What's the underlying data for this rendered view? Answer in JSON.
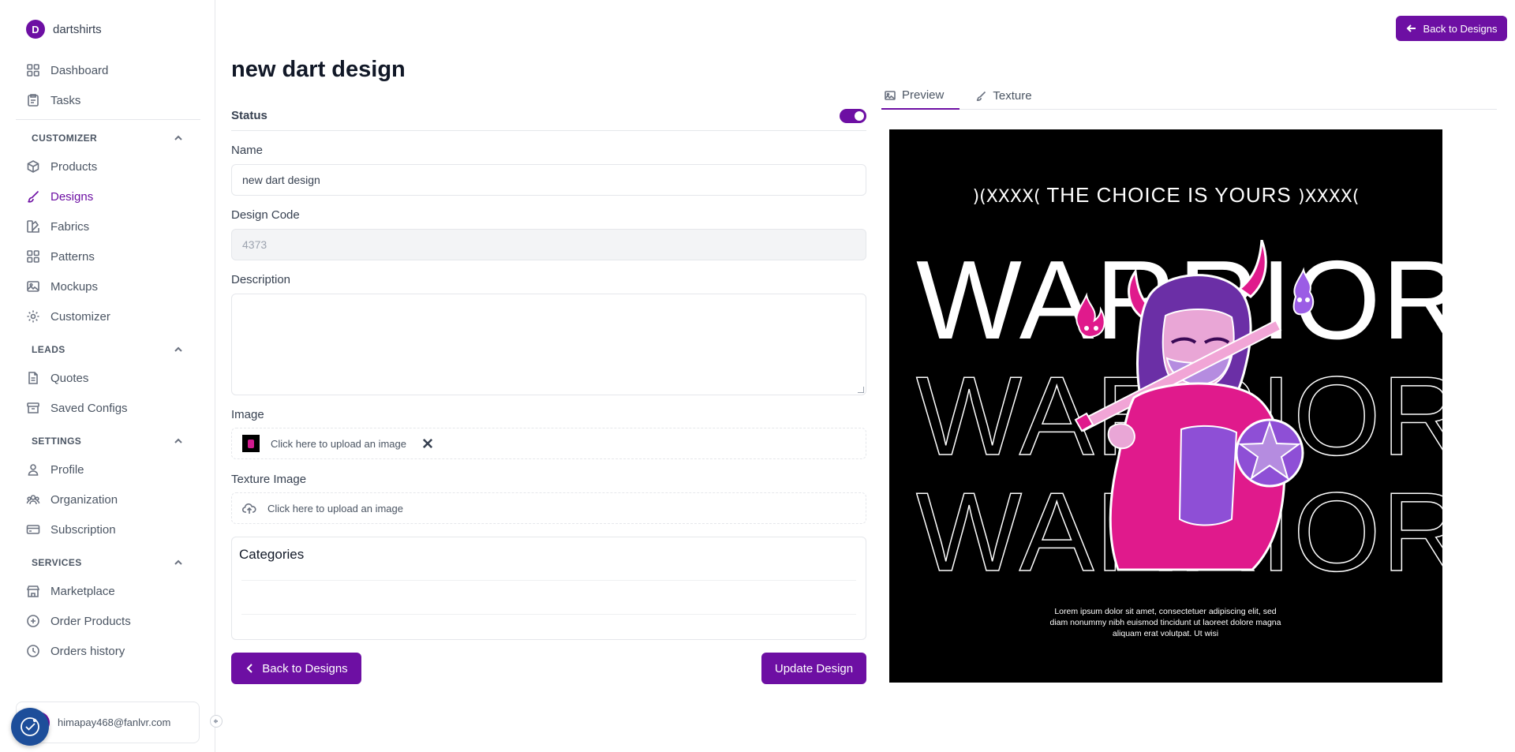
{
  "brand": {
    "initial": "D",
    "name": "dartshirts"
  },
  "sidebar": {
    "main_items": [
      {
        "label": "Dashboard",
        "icon": "grid-icon"
      },
      {
        "label": "Tasks",
        "icon": "clipboard-icon"
      }
    ],
    "sections": [
      {
        "title": "CUSTOMIZER",
        "items": [
          {
            "label": "Products",
            "icon": "box-icon"
          },
          {
            "label": "Designs",
            "icon": "brush-icon",
            "active": true
          },
          {
            "label": "Fabrics",
            "icon": "swatch-icon"
          },
          {
            "label": "Patterns",
            "icon": "grid-icon"
          },
          {
            "label": "Mockups",
            "icon": "image-icon"
          },
          {
            "label": "Customizer",
            "icon": "gear-icon"
          }
        ]
      },
      {
        "title": "LEADS",
        "items": [
          {
            "label": "Quotes",
            "icon": "file-icon"
          },
          {
            "label": "Saved Configs",
            "icon": "archive-icon"
          }
        ]
      },
      {
        "title": "SETTINGS",
        "items": [
          {
            "label": "Profile",
            "icon": "user-icon"
          },
          {
            "label": "Organization",
            "icon": "users-icon"
          },
          {
            "label": "Subscription",
            "icon": "card-icon"
          }
        ]
      },
      {
        "title": "SERVICES",
        "items": [
          {
            "label": "Marketplace",
            "icon": "store-icon"
          },
          {
            "label": "Order Products",
            "icon": "plus-circle-icon"
          },
          {
            "label": "Orders history",
            "icon": "clock-icon"
          }
        ]
      }
    ],
    "user_email": "himapay468@fanlvr.com"
  },
  "header": {
    "back_label": "Back to Designs"
  },
  "form": {
    "title": "new dart design",
    "status_label": "Status",
    "status_on": true,
    "name_label": "Name",
    "name_value": "new dart design",
    "code_label": "Design Code",
    "code_value": "4373",
    "description_label": "Description",
    "description_value": "",
    "image_label": "Image",
    "image_upload_text": "Click here to upload an image",
    "texture_label": "Texture Image",
    "texture_upload_text": "Click here to upload an image",
    "categories_title": "Categories",
    "back_button": "Back to Designs",
    "update_button": "Update Design"
  },
  "tabs": [
    {
      "label": "Preview",
      "icon": "image-icon",
      "active": true
    },
    {
      "label": "Texture",
      "icon": "brush-icon",
      "active": false
    }
  ],
  "artwork": {
    "tagline": "THE CHOICE IS YOURS",
    "ornament_left": ")(XXXX(",
    "ornament_right": ")XXXX(",
    "headline": "WARRIOR",
    "lorem": "Lorem ipsum dolor sit amet, consectetuer adipiscing elit, sed diam nonummy nibh euismod tincidunt ut laoreet dolore magna aliquam erat volutpat. Ut wisi"
  },
  "colors": {
    "accent": "#6d0fa3",
    "pink": "#e01a8c",
    "violet": "#9b5de5"
  }
}
